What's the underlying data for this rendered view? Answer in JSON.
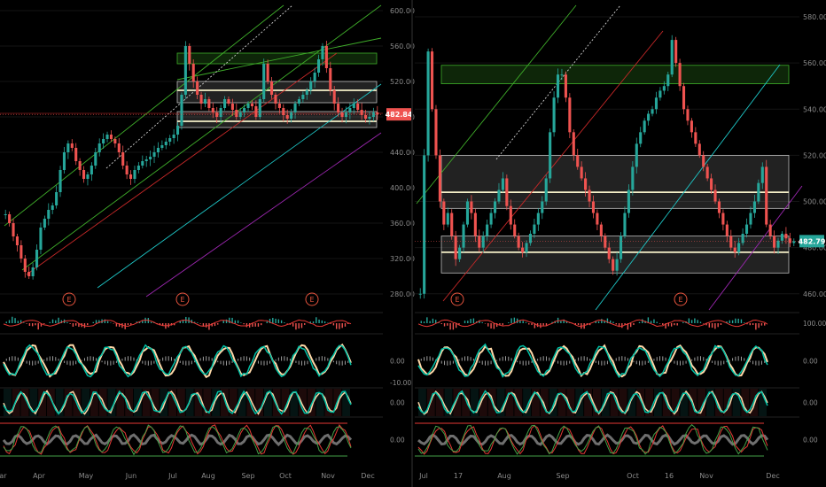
{
  "colors": {
    "background": "#000000",
    "up": "#26a69a",
    "down": "#ef5350",
    "price_label_bg": "#ef5350",
    "zone_fill": "#bdbdbd",
    "zone_line": "#f5f0c8",
    "green": "#3fae2a",
    "red": "#c62828",
    "teal": "#1ec8c8",
    "purple": "#9c27b0",
    "white_dotted": "#cfcfcf",
    "axis_text": "#8a8a8a",
    "macd_fast": "#00bfa5",
    "macd_slow": "#ffd8a8",
    "osc_red": "#e53935",
    "osc_green": "#43a047",
    "osc_gray": "#9e9e9e"
  },
  "chart_data": [
    {
      "type": "candlestick",
      "name": "left",
      "xlabel": "",
      "ylabel": "",
      "x_tick_labels": [
        "Mar",
        "Apr",
        "May",
        "Jun",
        "Jul",
        "Aug",
        "Sep",
        "Oct",
        "Nov",
        "Dec"
      ],
      "y_tick_labels": [
        "280.00",
        "320.00",
        "360.00",
        "400.00",
        "440.00",
        "480.00",
        "520.00",
        "560.00",
        "600.00"
      ],
      "ylim": [
        262,
        606
      ],
      "last_price": "482.84",
      "earnings_marker": "E",
      "earnings_x_labels_nearby": [
        "Apr",
        "Jul",
        "Oct"
      ],
      "zones": [
        {
          "low": 540,
          "high": 552
        },
        {
          "low": 496,
          "high": 520
        },
        {
          "low": 468,
          "high": 486
        }
      ],
      "zone_lines": [
        510,
        475
      ],
      "closes": [
        370,
        360,
        345,
        335,
        320,
        305,
        300,
        310,
        330,
        355,
        365,
        375,
        380,
        395,
        420,
        440,
        450,
        445,
        430,
        420,
        410,
        415,
        425,
        440,
        450,
        455,
        460,
        455,
        450,
        440,
        425,
        415,
        410,
        420,
        425,
        430,
        432,
        435,
        440,
        445,
        448,
        452,
        456,
        460,
        470,
        505,
        560,
        540,
        520,
        505,
        495,
        500,
        490,
        485,
        480,
        490,
        500,
        495,
        488,
        480,
        485,
        490,
        495,
        492,
        480,
        500,
        540,
        520,
        505,
        495,
        490,
        482,
        478,
        485,
        495,
        500,
        505,
        510,
        520,
        530,
        545,
        560,
        535,
        510,
        495,
        485,
        480,
        485,
        490,
        495,
        488,
        482,
        478,
        480,
        485,
        482.84
      ],
      "indicator_panels": [
        {
          "name": "momentum",
          "tick_labels": []
        },
        {
          "name": "macd",
          "tick_labels": [
            "0.00",
            "-10.00"
          ]
        },
        {
          "name": "stoch",
          "tick_labels": [
            "0.00"
          ]
        },
        {
          "name": "osc",
          "tick_labels": [
            "0.00"
          ]
        }
      ]
    },
    {
      "type": "candlestick",
      "name": "right",
      "xlabel": "",
      "ylabel": "",
      "x_tick_labels": [
        "Jul",
        "17",
        "Aug",
        "Sep",
        "Oct",
        "16",
        "Nov",
        "Dec"
      ],
      "y_tick_labels": [
        "460.00",
        "480.00",
        "500.00",
        "520.00",
        "540.00",
        "560.00",
        "580.00"
      ],
      "ylim": [
        453,
        585
      ],
      "last_price": "482.79",
      "earnings_marker": "E",
      "zones": [
        {
          "low": 551,
          "high": 559
        },
        {
          "low": 497,
          "high": 520
        },
        {
          "low": 469,
          "high": 485
        }
      ],
      "zone_lines": [
        504,
        478
      ],
      "closes": [
        460,
        520,
        565,
        540,
        520,
        500,
        490,
        495,
        485,
        475,
        480,
        490,
        500,
        495,
        485,
        480,
        485,
        490,
        495,
        500,
        505,
        510,
        498,
        490,
        485,
        480,
        478,
        482,
        486,
        490,
        495,
        500,
        510,
        530,
        545,
        555,
        555,
        545,
        530,
        520,
        515,
        510,
        505,
        500,
        495,
        490,
        485,
        480,
        475,
        470,
        475,
        485,
        495,
        505,
        515,
        525,
        530,
        535,
        538,
        540,
        545,
        548,
        550,
        555,
        570,
        560,
        550,
        540,
        535,
        530,
        525,
        520,
        515,
        510,
        505,
        500,
        495,
        490,
        485,
        480,
        478,
        482,
        486,
        490,
        495,
        500,
        508,
        515,
        490,
        485,
        480,
        483,
        486,
        484,
        482,
        482.79
      ],
      "indicator_panels": [
        {
          "name": "momentum",
          "tick_labels": [
            "100.00"
          ]
        },
        {
          "name": "macd",
          "tick_labels": [
            "0.00"
          ]
        },
        {
          "name": "stoch",
          "tick_labels": [
            "0.00"
          ]
        },
        {
          "name": "osc",
          "tick_labels": [
            "0.00"
          ]
        }
      ]
    }
  ]
}
